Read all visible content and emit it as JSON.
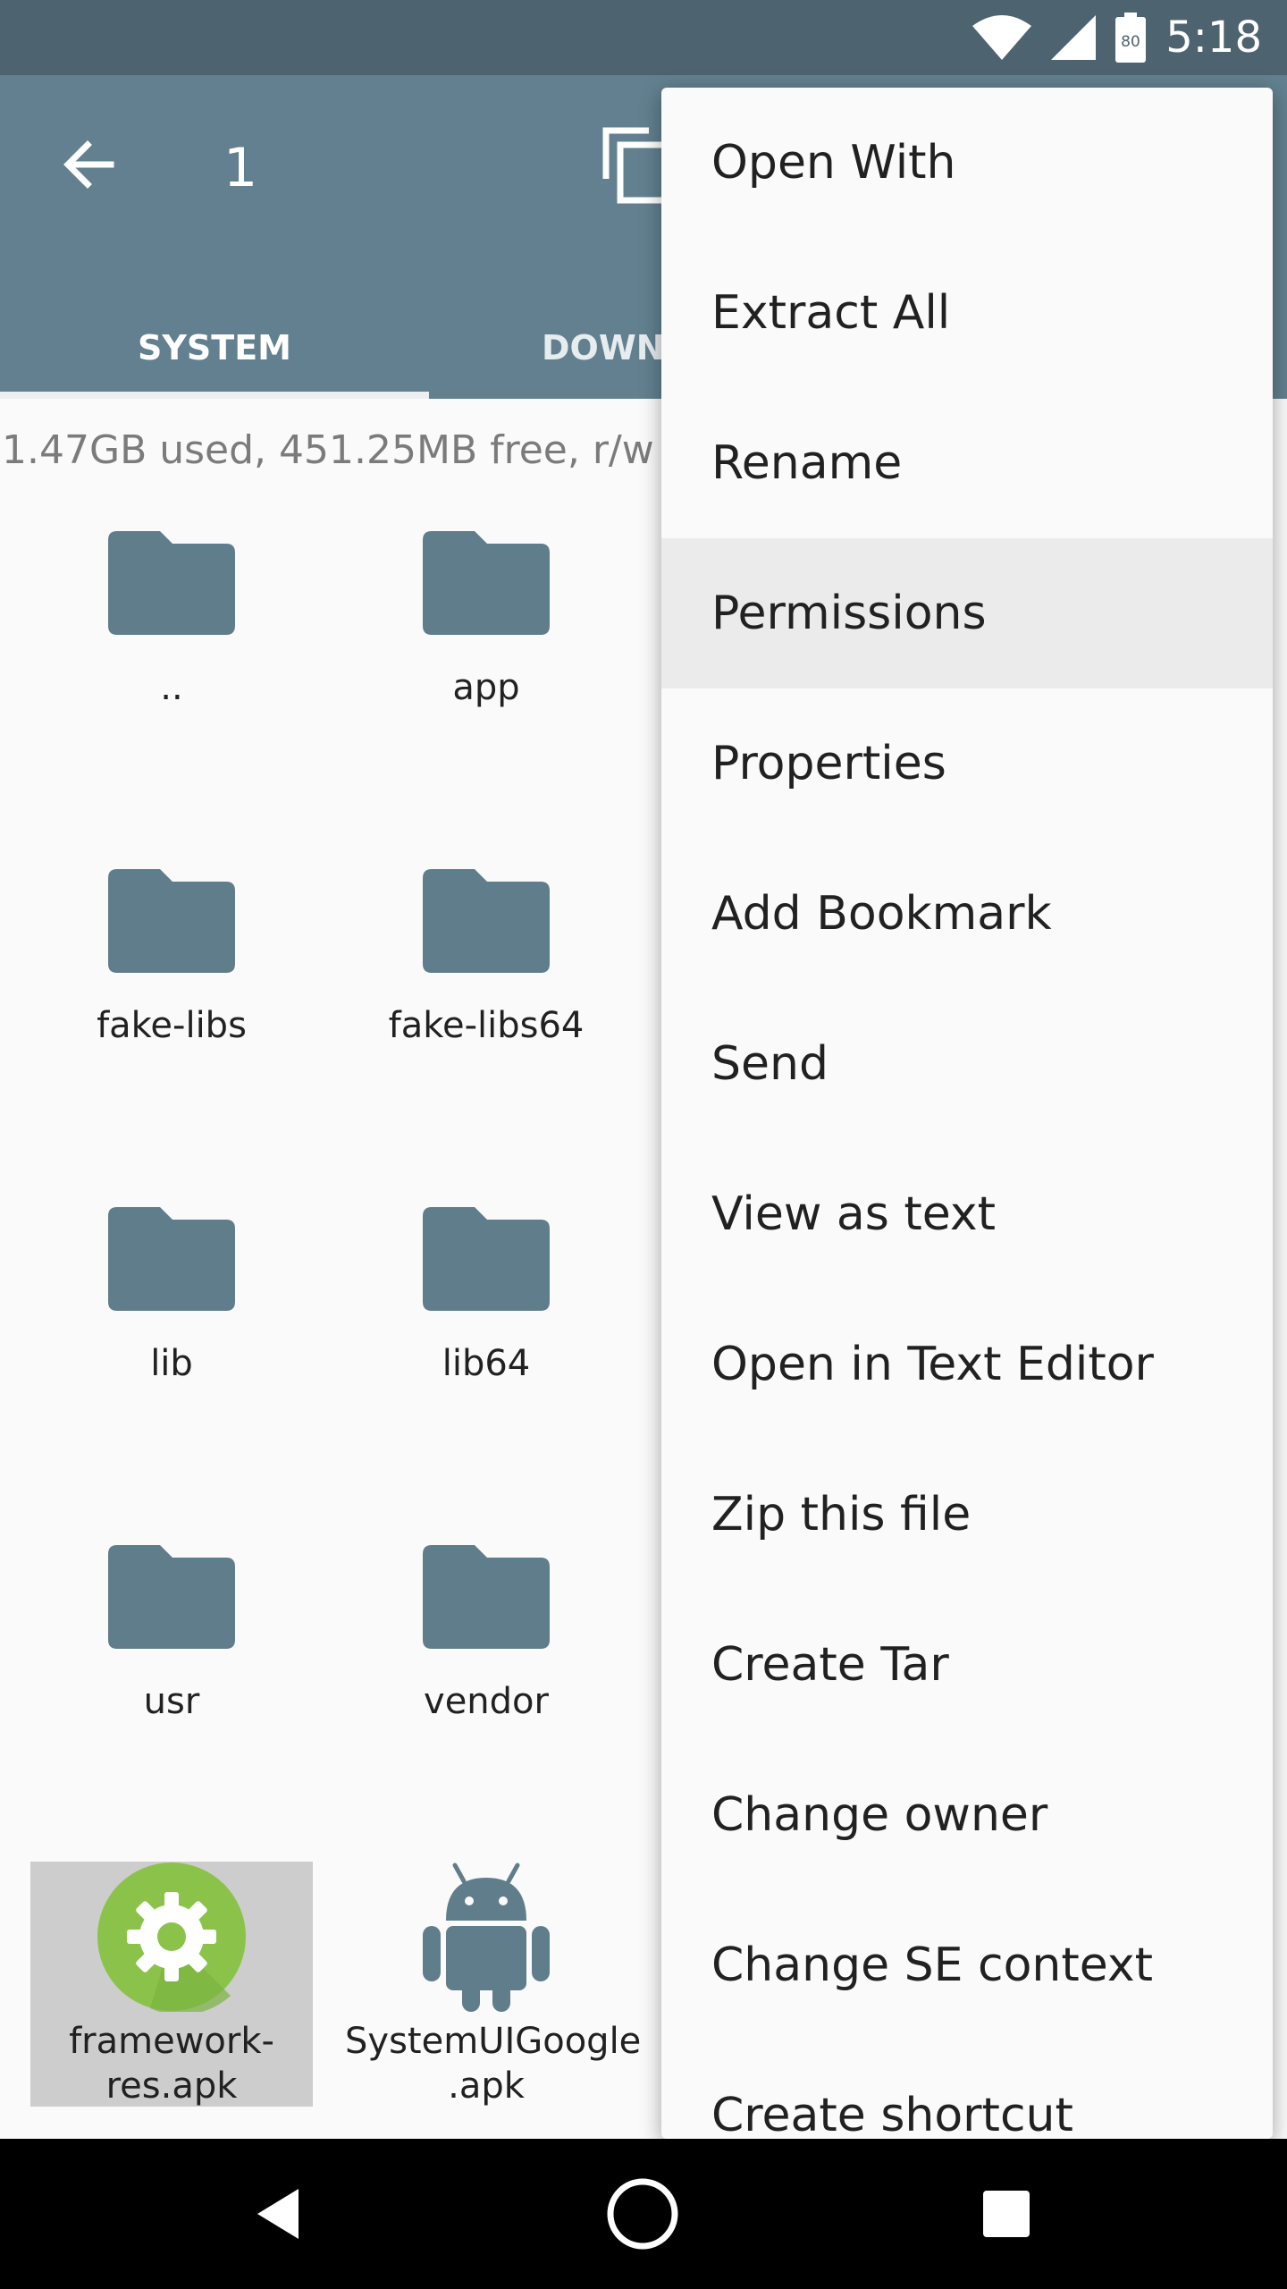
{
  "status_bar": {
    "time": "5:18",
    "battery_level": "80",
    "icons": [
      "wifi-icon",
      "signal-icon",
      "battery-icon"
    ]
  },
  "app_bar": {
    "count": "1",
    "tabs": [
      {
        "label": "SYSTEM",
        "active": true
      },
      {
        "label": "DOWNL",
        "active": false
      }
    ]
  },
  "storage_info": "1.47GB used, 451.25MB free, r/w",
  "files": [
    {
      "name": "..",
      "type": "folder"
    },
    {
      "name": "app",
      "type": "folder"
    },
    {
      "name": "fake-libs",
      "type": "folder"
    },
    {
      "name": "fake-libs64",
      "type": "folder"
    },
    {
      "name": "lib",
      "type": "folder"
    },
    {
      "name": "lib64",
      "type": "folder"
    },
    {
      "name": "usr",
      "type": "folder"
    },
    {
      "name": "vendor",
      "type": "folder"
    },
    {
      "name_line1": "framework-",
      "name_line2": "res.apk",
      "type": "apk-settings",
      "selected": true
    },
    {
      "name_line1": "SystemUIGoogle",
      "name_line2": ".apk",
      "type": "apk-android",
      "selected": false
    }
  ],
  "menu": {
    "items": [
      "Open With",
      "Extract All",
      "Rename",
      "Permissions",
      "Properties",
      "Add Bookmark",
      "Send",
      "View as text",
      "Open in Text Editor",
      "Zip this file",
      "Create Tar",
      "Change owner",
      "Change SE context",
      "Create shortcut"
    ],
    "highlighted": "Permissions"
  },
  "colors": {
    "status_bar": "#4e6370",
    "app_bar": "#62808f",
    "folder": "#607d8b",
    "apk_settings": "#8bc34a"
  }
}
